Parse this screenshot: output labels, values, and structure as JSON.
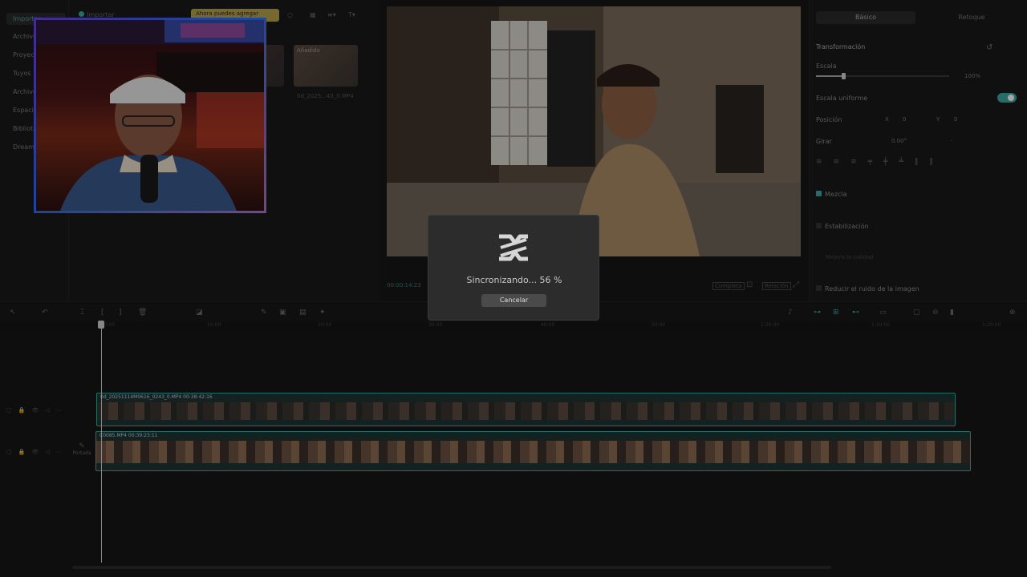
{
  "sidebar": {
    "items": [
      {
        "label": "Importar"
      },
      {
        "label": "Archivos"
      },
      {
        "label": "Proyectos"
      },
      {
        "label": "Tuyos"
      },
      {
        "label": "Archivos"
      },
      {
        "label": "Espacio"
      },
      {
        "label": "Biblioteca"
      },
      {
        "label": "Dreamina"
      }
    ]
  },
  "media": {
    "import_label": "Importar",
    "notice": "Ahora puedes agregar",
    "added_label": "Añadido",
    "clip_meta": "0d_2025...43_0.MP4"
  },
  "player": {
    "timecode": "00:00:14:23",
    "full_label": "Completa",
    "ratio_label": "Relación"
  },
  "inspector": {
    "tab_basic": "Básico",
    "tab_retouch": "Retoque",
    "transform": "Transformación",
    "scale": "Escala",
    "scale_value": "100%",
    "uniform_scale": "Escala uniforme",
    "position": "Posición",
    "pos_x_label": "X",
    "pos_x": "0",
    "pos_y_label": "Y",
    "pos_y": "0",
    "rotate": "Girar",
    "rotate_value": "0.00°",
    "rotate_dash": "-",
    "blend": "Mezcla",
    "stabilization": "Estabilización",
    "stabilization_hint": "Mejora la calidad",
    "noise": "Reducir el ruido de la imagen"
  },
  "timeline": {
    "ticks": [
      "00:00",
      "10:00",
      "20:00",
      "30:00",
      "40:00",
      "50:00",
      "1:00:00",
      "1:10:00",
      "1:20:00"
    ],
    "track1_clip": "0d_20251114M0616_0243_0.MP4   00:38:42:16",
    "track2_clip": "C0085.MP4   00:39:23:11",
    "cover_label": "Portada"
  },
  "dialog": {
    "status": "Sincronizando... 56 %",
    "cancel": "Cancelar"
  },
  "colors": {
    "accent": "#3aa89d",
    "notice": "#b6a24b"
  }
}
